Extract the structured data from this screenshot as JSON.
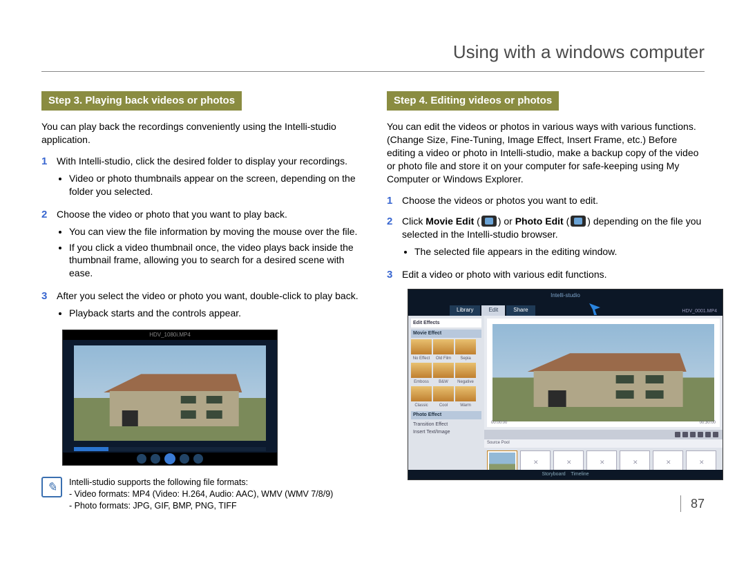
{
  "page_title": "Using with a windows computer",
  "page_number": "87",
  "left": {
    "step_header": "Step 3. Playing back videos or photos",
    "intro": "You can play back the recordings conveniently using the Intelli-studio application.",
    "items": [
      {
        "n": "1",
        "text": "With Intelli-studio, click the desired folder to display your recordings.",
        "bullets": [
          "Video or photo thumbnails appear on the screen, depending on the folder you selected."
        ]
      },
      {
        "n": "2",
        "text": "Choose the video or photo that you want to play back.",
        "bullets": [
          "You can view the file information by moving the mouse over the file.",
          "If you click a video thumbnail once, the video plays back inside the thumbnail frame, allowing you to search for a desired scene with ease."
        ]
      },
      {
        "n": "3",
        "text": "After you select the video or photo you want, double-click to play back.",
        "bullets": [
          "Playback starts and the controls appear."
        ]
      }
    ],
    "player_title": "HDV_1080i.MP4",
    "note_lines": [
      "Intelli-studio supports the following file formats:",
      "- Video formats: MP4 (Video: H.264, Audio: AAC), WMV (WMV 7/8/9)",
      "- Photo formats: JPG, GIF, BMP, PNG, TIFF"
    ]
  },
  "right": {
    "step_header": "Step 4. Editing videos or photos",
    "intro": "You can edit the videos or photos in various ways with various functions. (Change Size, Fine-Tuning, Image Effect, Insert Frame, etc.) Before editing a video or photo in Intelli-studio, make a backup copy of the video or photo file and store it on your computer for safe-keeping using My Computer or Windows Explorer.",
    "items": [
      {
        "n": "1",
        "text": "Choose the videos or photos you want to edit.",
        "bullets": []
      },
      {
        "n": "2",
        "pre": "Click ",
        "bold1": "Movie Edit",
        "mid1": " (",
        "mid2": ") or ",
        "bold2": "Photo Edit",
        "mid3": " (",
        "post": ") depending on the file you selected in the Intelli-studio browser.",
        "bullets": [
          "The selected file appears in the editing window."
        ]
      },
      {
        "n": "3",
        "text": "Edit a video or photo with various edit functions.",
        "bullets": []
      }
    ],
    "editor": {
      "logo": "Intelli-studio",
      "tabs": [
        "Library",
        "Edit",
        "Share"
      ],
      "active_tab": "Edit",
      "filename": "HDV_0001.MP4",
      "side_title": "Edit Effects",
      "section1": "Movie Effect",
      "row_thumb_labels": [
        "No Effect",
        "Old Film",
        "Sepia",
        "Emboss",
        "B&W",
        "Negative",
        "Classic",
        "Cool",
        "Warm"
      ],
      "section2": "Photo Effect",
      "rows": [
        "Transition Effect",
        "Insert Text/Image"
      ],
      "source_pool": "Source Pool",
      "time_start": "00:00:00",
      "time_end": "00:30:00",
      "bottom_labels": [
        "Storyboard",
        "Timeline"
      ]
    }
  }
}
